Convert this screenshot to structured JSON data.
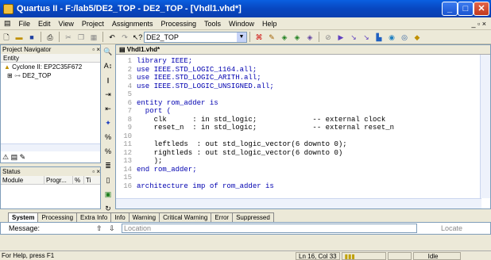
{
  "window": {
    "title": "Quartus II - F:/lab5/DE2_TOP - DE2_TOP - [Vhdl1.vhd*]"
  },
  "menu": [
    "File",
    "Edit",
    "View",
    "Project",
    "Assignments",
    "Processing",
    "Tools",
    "Window",
    "Help"
  ],
  "toolbar": {
    "project_combo": "DE2_TOP"
  },
  "navigator": {
    "title": "Project Navigator",
    "header": "Entity",
    "items": [
      "Cyclone II: EP2C35F672",
      "DE2_TOP"
    ]
  },
  "status_panel": {
    "title": "Status",
    "columns": [
      "Module",
      "Progr...",
      "%",
      "Ti"
    ]
  },
  "editor": {
    "tab": "Vhdl1.vhd*",
    "lines": [
      {
        "n": "1",
        "code": "library IEEE;"
      },
      {
        "n": "2",
        "code": "use IEEE.STD_LOGIC_1164.all;"
      },
      {
        "n": "3",
        "code": "use IEEE.STD_LOGIC_ARITH.all;"
      },
      {
        "n": "4",
        "code": "use IEEE.STD_LOGIC_UNSIGNED.all;"
      },
      {
        "n": "5",
        "code": ""
      },
      {
        "n": "6",
        "code": "entity rom_adder is"
      },
      {
        "n": "7",
        "code": "  port ("
      },
      {
        "n": "8",
        "code": "    clk      : in std_logic;             -- external clock"
      },
      {
        "n": "9",
        "code": "    reset_n  : in std_logic;             -- external reset_n"
      },
      {
        "n": "10",
        "code": ""
      },
      {
        "n": "11",
        "code": "    leftleds  : out std_logic_vector(6 downto 0);"
      },
      {
        "n": "12",
        "code": "    rightleds : out std_logic_vector(6 downto 0)"
      },
      {
        "n": "13",
        "code": "    );"
      },
      {
        "n": "14",
        "code": "end rom_adder;"
      },
      {
        "n": "15",
        "code": ""
      },
      {
        "n": "16",
        "code": "architecture imp of rom_adder is"
      }
    ]
  },
  "messages": {
    "tabs": [
      "System",
      "Processing",
      "Extra Info",
      "Info",
      "Warning",
      "Critical Warning",
      "Error",
      "Suppressed"
    ],
    "message_label": "Message:",
    "location_placeholder": "Location",
    "locate_label": "Locate"
  },
  "statusbar": {
    "help": "For Help, press F1",
    "position": "Ln 16, Col 33",
    "state": "Idle"
  }
}
